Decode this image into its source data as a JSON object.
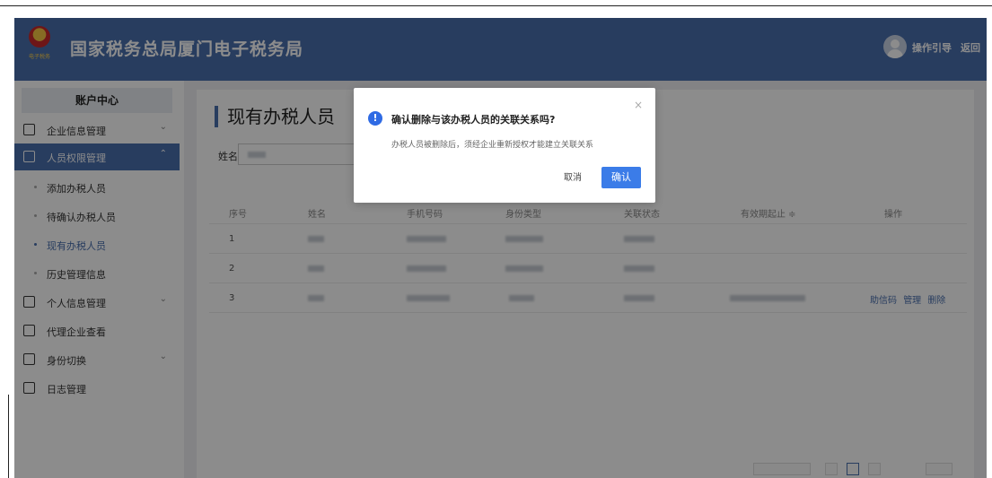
{
  "header": {
    "title": "国家税务总局厦门电子税务局",
    "logo_text": "电子税务",
    "guide_label": "操作引导",
    "back_label": "返回"
  },
  "sidebar": {
    "heading": "账户中心",
    "items": [
      {
        "label": "企业信息管理",
        "icon": "building-icon",
        "chevron": "⌄"
      },
      {
        "label": "人员权限管理",
        "icon": "user-permission-icon",
        "chevron": "⌃",
        "active": true
      },
      {
        "label": "个人信息管理",
        "icon": "id-card-icon",
        "chevron": "⌄"
      },
      {
        "label": "代理企业查看",
        "icon": "agency-icon",
        "chevron": ""
      },
      {
        "label": "身份切换",
        "icon": "switch-icon",
        "chevron": "⌄"
      },
      {
        "label": "日志管理",
        "icon": "log-icon",
        "chevron": ""
      }
    ],
    "subitems": [
      {
        "label": "添加办税人员"
      },
      {
        "label": "待确认办税人员"
      },
      {
        "label": "现有办税人员",
        "current": true
      },
      {
        "label": "历史管理信息"
      }
    ]
  },
  "main": {
    "title": "现有办税人员",
    "filter_label": "姓名",
    "table": {
      "headers": [
        "序号",
        "姓名",
        "手机号码",
        "身份类型",
        "关联状态",
        "有效期起止 ≑",
        "操作"
      ],
      "rows": [
        {
          "index": "1"
        },
        {
          "index": "2"
        },
        {
          "index": "3",
          "actions": [
            "助信码",
            "管理",
            "删除"
          ]
        }
      ]
    }
  },
  "dialog": {
    "icon": "!",
    "title": "确认删除与该办税人员的关联关系吗?",
    "message": "办税人员被删除后，须经企业重新授权才能建立关联关系",
    "cancel_label": "取消",
    "confirm_label": "确认",
    "close_glyph": "×"
  },
  "colors": {
    "brand": "#4a6fae",
    "primary_button": "#3b7ce8"
  }
}
